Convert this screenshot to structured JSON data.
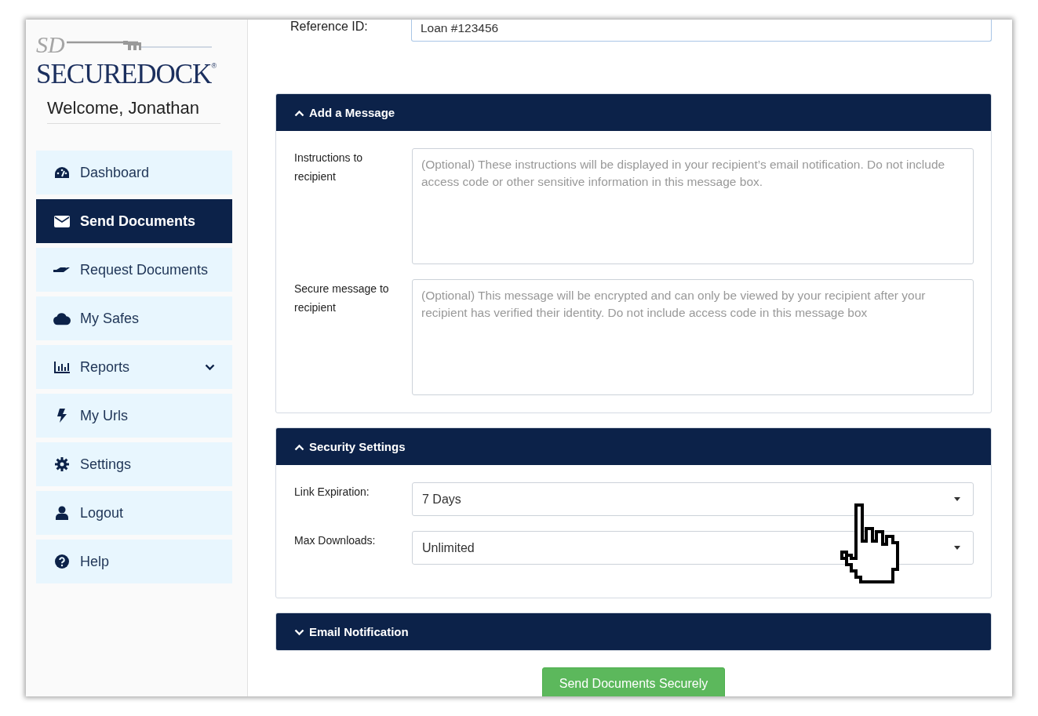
{
  "logo": {
    "monogram": "SD",
    "name": "SECUREDOCK",
    "mark": "®"
  },
  "welcome": "Welcome, Jonathan",
  "sidebar": {
    "items": [
      {
        "label": "Dashboard",
        "selected": false,
        "has_submenu": false
      },
      {
        "label": "Send Documents",
        "selected": true,
        "has_submenu": false
      },
      {
        "label": "Request Documents",
        "selected": false,
        "has_submenu": false
      },
      {
        "label": "My Safes",
        "selected": false,
        "has_submenu": false
      },
      {
        "label": "Reports",
        "selected": false,
        "has_submenu": true
      },
      {
        "label": "My Urls",
        "selected": false,
        "has_submenu": false
      },
      {
        "label": "Settings",
        "selected": false,
        "has_submenu": false
      },
      {
        "label": "Logout",
        "selected": false,
        "has_submenu": false
      },
      {
        "label": "Help",
        "selected": false,
        "has_submenu": false
      }
    ]
  },
  "reference": {
    "label": "Reference ID:",
    "value": "Loan #123456"
  },
  "sections": [
    {
      "title": "Add a Message",
      "expanded": true,
      "fields": [
        {
          "kind": "textarea",
          "label": "Instructions to recipient",
          "placeholder": "(Optional) These instructions will be displayed in your recipient’s email notification. Do not include access code or other sensitive information in this message box."
        },
        {
          "kind": "textarea",
          "label": "Secure message to recipient",
          "placeholder": "(Optional) This message will be encrypted and can only be viewed by your recipient after your recipient has verified their identity. Do not include access code in this message box"
        }
      ]
    },
    {
      "title": "Security Settings",
      "expanded": true,
      "fields": [
        {
          "kind": "select",
          "label": "Link Expiration:",
          "value": "7 Days"
        },
        {
          "kind": "select",
          "label": "Max Downloads:",
          "value": "Unlimited"
        }
      ]
    },
    {
      "title": "Email Notification",
      "expanded": false
    }
  ],
  "submit_button": "Send Documents Securely"
}
